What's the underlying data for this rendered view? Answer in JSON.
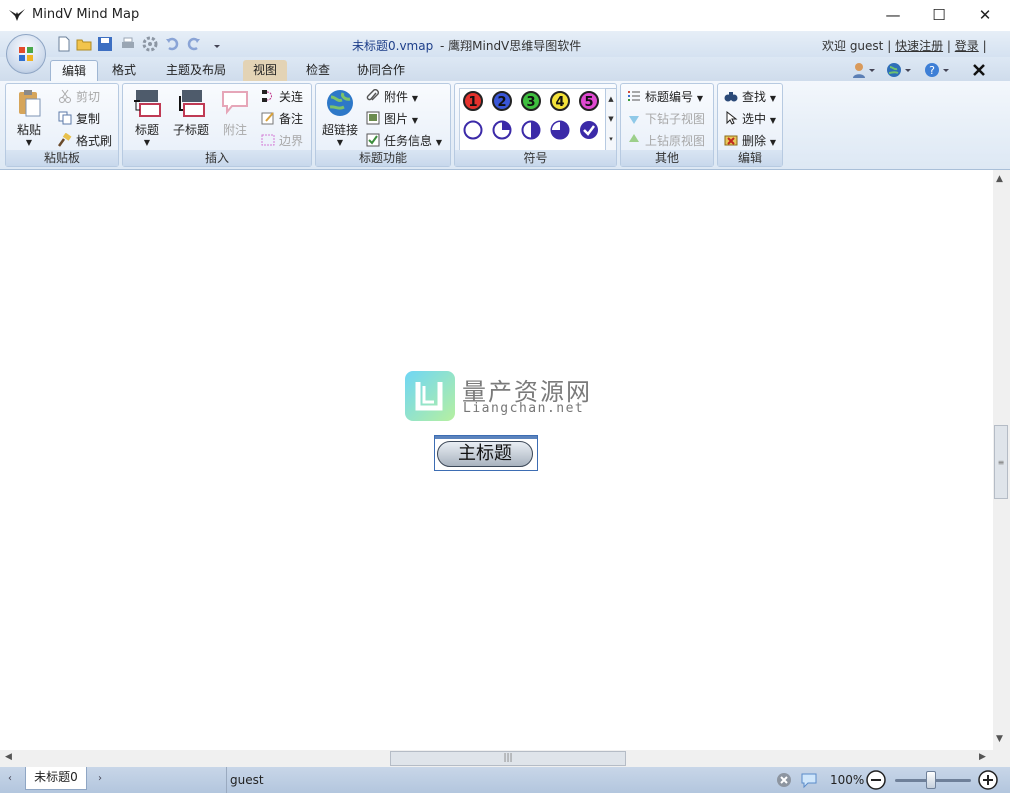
{
  "window": {
    "app_title": "MindV Mind Map",
    "minimize_glyph": "—",
    "maximize_glyph": "☐",
    "close_glyph": "✕"
  },
  "document": {
    "title": "未标题0.vmap",
    "subtitle": "- 鹰翔MindV思维导图软件"
  },
  "user": {
    "welcome": "欢迎 guest",
    "register": "快速注册",
    "login": "登录"
  },
  "tabs": [
    "编辑",
    "格式",
    "主题及布局",
    "视图",
    "检查",
    "协同合作"
  ],
  "ribbon": {
    "clipboard": {
      "label": "粘贴板",
      "paste": "粘贴",
      "cut": "剪切",
      "copy": "复制",
      "format_painter": "格式刷"
    },
    "insert": {
      "label": "插入",
      "topic": "标题",
      "subtopic": "子标题",
      "callout": "附注",
      "relation": "关连",
      "note": "备注",
      "boundary": "边界"
    },
    "topic_functions": {
      "label": "标题功能",
      "hyperlink": "超链接",
      "attachment": "附件",
      "image": "图片",
      "task_info": "任务信息"
    },
    "symbols": {
      "label": "符号",
      "numbers": [
        "1",
        "2",
        "3",
        "4",
        "5"
      ],
      "number_colors": [
        "#e5322d",
        "#3a57d8",
        "#3fbf3f",
        "#f4e23a",
        "#e04ad1"
      ]
    },
    "other": {
      "label": "其他",
      "topic_numbering": "标题编号",
      "down_subview": "下钻子视图",
      "up_parentview": "上钻原视图"
    },
    "edit": {
      "label": "编辑",
      "find": "查找",
      "select": "选中",
      "delete": "删除"
    }
  },
  "canvas": {
    "watermark_title": "量产资源网",
    "watermark_url": "Liangchan.net",
    "central_topic": "主标题"
  },
  "status_bar": {
    "doc_tab": "未标题0",
    "user": "guest",
    "zoom": "100%",
    "zoom_level": 1.0
  },
  "colors": {
    "accent": "#3d6db3",
    "ribbon_bg": "#dde8f4"
  }
}
